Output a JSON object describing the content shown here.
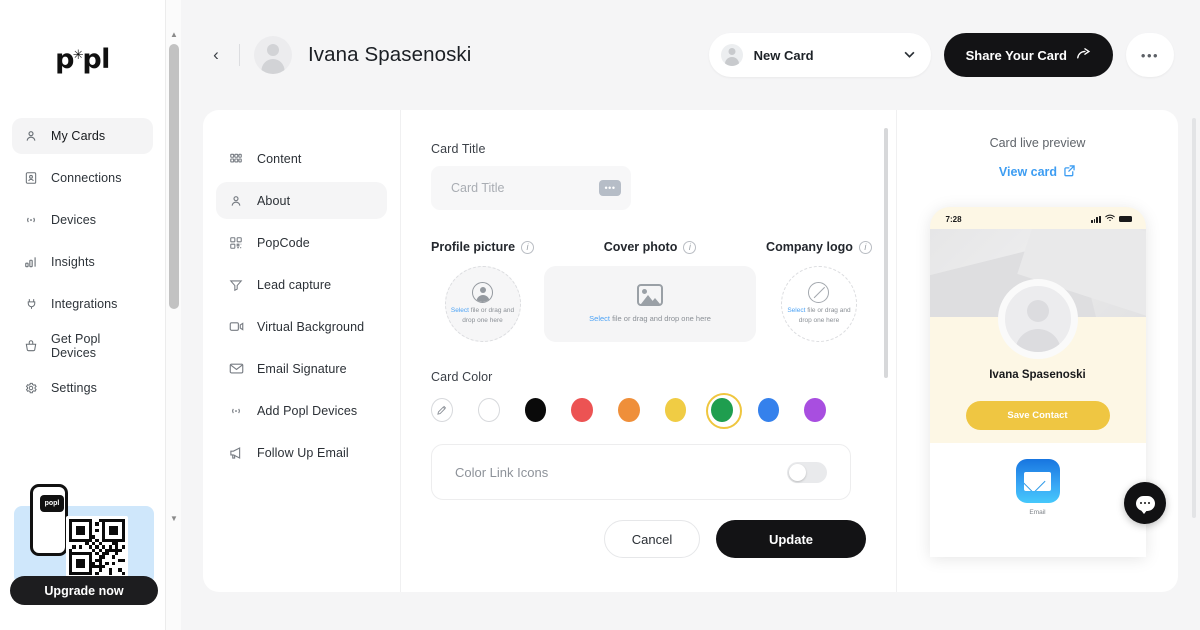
{
  "sidebar": {
    "logo": "popl",
    "items": [
      {
        "label": "My Cards",
        "icon": "person-icon",
        "active": true
      },
      {
        "label": "Connections",
        "icon": "contact-card-icon",
        "active": false
      },
      {
        "label": "Devices",
        "icon": "nfc-icon",
        "active": false
      },
      {
        "label": "Insights",
        "icon": "bar-chart-icon",
        "active": false
      },
      {
        "label": "Integrations",
        "icon": "plug-icon",
        "active": false
      },
      {
        "label": "Get Popl Devices",
        "icon": "basket-icon",
        "active": false
      },
      {
        "label": "Settings",
        "icon": "gear-icon",
        "active": false
      }
    ],
    "promo": {
      "phone_badge": "popl",
      "button_label": "Upgrade now"
    }
  },
  "topbar": {
    "back_icon": "chevron-left-icon",
    "profile_name": "Ivana Spasenoski",
    "card_selector": {
      "value": "New Card",
      "chevron": "chevron-down-icon"
    },
    "share_button": "Share Your Card",
    "share_icon": "share-arrow-icon",
    "more_button": "•••"
  },
  "subnav": {
    "items": [
      {
        "label": "Content",
        "icon": "grid-icon",
        "active": false
      },
      {
        "label": "About",
        "icon": "person-icon",
        "active": true
      },
      {
        "label": "PopCode",
        "icon": "qr-code-icon",
        "active": false
      },
      {
        "label": "Lead capture",
        "icon": "funnel-icon",
        "active": false
      },
      {
        "label": "Virtual Background",
        "icon": "video-camera-icon",
        "active": false
      },
      {
        "label": "Email Signature",
        "icon": "envelope-icon",
        "active": false
      },
      {
        "label": "Add Popl Devices",
        "icon": "nfc-icon",
        "active": false
      },
      {
        "label": "Follow Up Email",
        "icon": "megaphone-icon",
        "active": false
      }
    ]
  },
  "form": {
    "card_title": {
      "label": "Card Title",
      "placeholder": "Card Title",
      "value": "",
      "badge": "•••"
    },
    "media": {
      "profile_picture": {
        "label": "Profile picture",
        "info_icon": "info-icon",
        "select_text": "Select",
        "rest_text": " file or drag and drop one here",
        "icon": "avatar-placeholder-icon"
      },
      "cover_photo": {
        "label": "Cover photo",
        "info_icon": "info-icon",
        "select_text": "Select",
        "rest_text": " file or drag and drop one here",
        "icon": "image-placeholder-icon"
      },
      "company_logo": {
        "label": "Company logo",
        "info_icon": "info-icon",
        "select_text": "Select",
        "rest_text": " file or drag and drop one here",
        "icon": "no-logo-icon"
      }
    },
    "card_color": {
      "label": "Card Color",
      "selected_index": 6,
      "swatches": [
        {
          "name": "custom-color-picker",
          "color": "#ffffff",
          "kind": "picker"
        },
        {
          "name": "white",
          "color": "#ffffff",
          "kind": "outline"
        },
        {
          "name": "black",
          "color": "#0a0a0a",
          "kind": "solid"
        },
        {
          "name": "red",
          "color": "#ec5353",
          "kind": "solid"
        },
        {
          "name": "orange",
          "color": "#ef8f3a",
          "kind": "solid"
        },
        {
          "name": "yellow",
          "color": "#f0cc44",
          "kind": "solid"
        },
        {
          "name": "green",
          "color": "#1f9e4f",
          "kind": "solid"
        },
        {
          "name": "blue",
          "color": "#3581ec",
          "kind": "solid"
        },
        {
          "name": "purple",
          "color": "#a84ee0",
          "kind": "solid"
        }
      ]
    },
    "color_link_icons": {
      "label": "Color Link Icons",
      "enabled": false
    },
    "buttons": {
      "cancel": "Cancel",
      "update": "Update"
    }
  },
  "preview": {
    "title": "Card live preview",
    "view_card": "View card",
    "external_icon": "external-link-icon",
    "phone": {
      "status_time": "7:28",
      "signal_icon": "cellular-bars-icon",
      "wifi_icon": "wifi-icon",
      "battery_icon": "battery-icon",
      "name": "Ivana Spasenoski",
      "save_contact": "Save Contact",
      "link": {
        "label": "Email",
        "icon": "email-app-icon"
      }
    },
    "chat_icon": "chat-bubble-icon"
  },
  "colors": {
    "accent_yellow": "#efc642",
    "dark": "#131315",
    "link_blue": "#3d9df2",
    "page_bg": "#f5f5f6"
  }
}
